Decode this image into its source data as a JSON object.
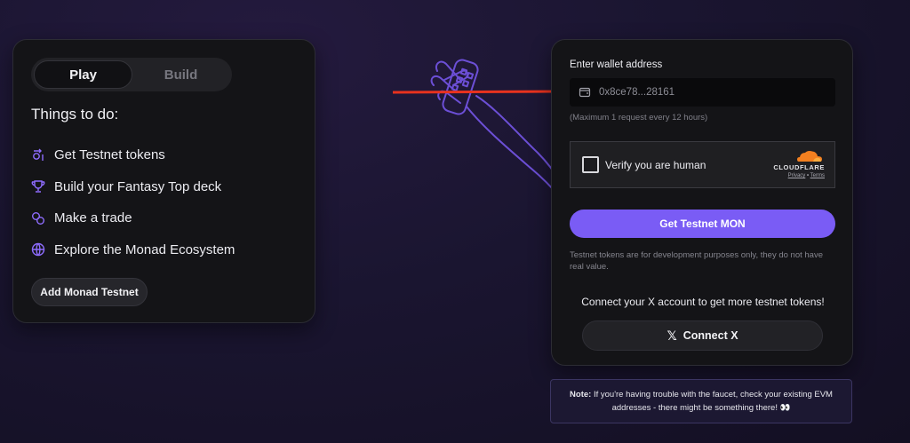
{
  "left_card": {
    "tabs": [
      {
        "label": "Play",
        "active": true
      },
      {
        "label": "Build",
        "active": false
      }
    ],
    "title": "Things to do:",
    "items": [
      {
        "label": "Get Testnet tokens",
        "icon": "coins-icon"
      },
      {
        "label": "Build your Fantasy Top deck",
        "icon": "trophy-icon"
      },
      {
        "label": "Make a trade",
        "icon": "exchange-icon"
      },
      {
        "label": "Explore the Monad Ecosystem",
        "icon": "globe-icon"
      }
    ],
    "add_button": "Add Monad Testnet"
  },
  "faucet": {
    "wallet_label": "Enter wallet address",
    "wallet_value": "0x8ce78...28161",
    "wallet_icon": "wallet-icon",
    "rate_note": "(Maximum 1 request every 12 hours)",
    "captcha": {
      "label": "Verify you are human",
      "provider": "CLOUDFLARE",
      "privacy": "Privacy",
      "separator": "•",
      "terms": "Terms"
    },
    "get_button": "Get Testnet MON",
    "disclaimer": "Testnet tokens are for development purposes only, they do not have real value.",
    "connect_prompt": "Connect your X account to get more testnet tokens!",
    "connect_button": "Connect X",
    "connect_icon": "x-logo-icon"
  },
  "note": {
    "label": "Note:",
    "text": "If you're having trouble with the faucet, check your existing EVM addresses - there might be something there! 👀"
  },
  "colors": {
    "accent": "#7a5cf5",
    "arrow": "#e8321e",
    "cloudflare": "#f38020",
    "card_bg": "#141417"
  }
}
